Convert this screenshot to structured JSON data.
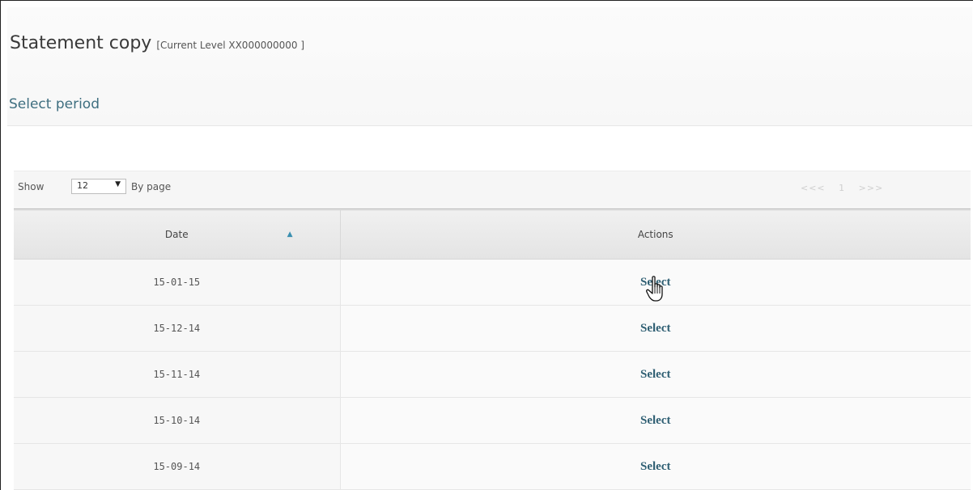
{
  "header": {
    "title": "Statement copy",
    "title_suffix": "[Current Level XX000000000 ]",
    "select_period_label": "Select period"
  },
  "toolbar": {
    "show_label": "Show",
    "page_size_value": "12",
    "by_page_label": "By page",
    "pager": {
      "prev": "<<<",
      "current": "1",
      "next": ">>>"
    },
    "icons": {
      "dropdown": "dropdown-arrow-icon",
      "sort": "sort-ascending-icon"
    }
  },
  "table": {
    "columns": [
      "Date",
      "Actions"
    ],
    "rows": [
      {
        "date": "15-01-15",
        "action": "Select"
      },
      {
        "date": "15-12-14",
        "action": "Select"
      },
      {
        "date": "15-11-14",
        "action": "Select"
      },
      {
        "date": "15-10-14",
        "action": "Select"
      },
      {
        "date": "15-09-14",
        "action": "Select"
      }
    ]
  },
  "colors": {
    "link": "#2f5f73",
    "sort_arrow": "#3a8fb0",
    "header_bg": "#f9f9f9"
  },
  "cursor": {
    "icon": "hand-pointer-icon"
  }
}
